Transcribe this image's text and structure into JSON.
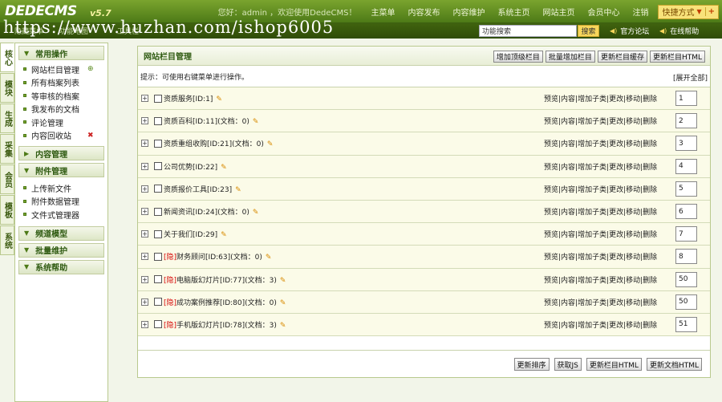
{
  "header": {
    "logo": "DEDECMS",
    "version": "v5.7",
    "welcome": "您好：admin ，欢迎使用DedeCMS！",
    "nav": [
      "主菜单",
      "内容发布",
      "内容维护",
      "系统主页",
      "网站主页",
      "会员中心",
      "注销"
    ],
    "quick_label": "快捷方式",
    "quick_plus": "+"
  },
  "subbar": {
    "items": [
      "隐藏菜单",
      "功能地图",
      "工具栏"
    ],
    "watermark": "https://www.huzhan.com/ishop6005",
    "search_value": "功能搜索",
    "search_button": "搜索",
    "links": [
      "官方论坛",
      "在线帮助"
    ]
  },
  "vtabs": [
    "核心",
    "模块",
    "生成",
    "采集",
    "会员",
    "模板",
    "系统"
  ],
  "menu": {
    "groups": [
      {
        "title": "常用操作",
        "items": [
          "网站栏目管理",
          "所有档案列表",
          "等审核的档案",
          "我发布的文档",
          "评论管理",
          "内容回收站"
        ]
      },
      {
        "title": "内容管理",
        "items": []
      },
      {
        "title": "附件管理",
        "items": [
          "上传新文件",
          "附件数据管理",
          "文件式管理器"
        ]
      },
      {
        "title": "频道模型",
        "items": []
      },
      {
        "title": "批量维护",
        "items": []
      },
      {
        "title": "系统帮助",
        "items": []
      }
    ]
  },
  "main": {
    "title": "网站栏目管理",
    "head_buttons": [
      "增加顶级栏目",
      "批量增加栏目",
      "更新栏目缓存",
      "更新栏目HTML"
    ],
    "tip": "提示：可使用右键菜单进行操作。",
    "expand_all": "[展开全部]",
    "ops": "预览|内容|增加子类|更改|移动|删除",
    "rows": [
      {
        "tag": "",
        "name": "资质服务[ID:1]",
        "order": "1"
      },
      {
        "tag": "",
        "name": "资质百科[ID:11](文档：0)",
        "order": "2"
      },
      {
        "tag": "",
        "name": "资质重组收购[ID:21](文档：0)",
        "order": "3"
      },
      {
        "tag": "",
        "name": "公司优势[ID:22]",
        "order": "4"
      },
      {
        "tag": "",
        "name": "资质报价工具[ID:23]",
        "order": "5"
      },
      {
        "tag": "",
        "name": "新闻资讯[ID:24](文档：0)",
        "order": "6"
      },
      {
        "tag": "",
        "name": "关于我们[ID:29]",
        "order": "7"
      },
      {
        "tag": "[隐]",
        "name": "财务顾问[ID:63](文档：0)",
        "order": "8"
      },
      {
        "tag": "[隐]",
        "name": "电脑版幻灯片[ID:77](文档：3)",
        "order": "50"
      },
      {
        "tag": "[隐]",
        "name": "成功案例推荐[ID:80](文档：0)",
        "order": "50"
      },
      {
        "tag": "[隐]",
        "name": "手机版幻灯片[ID:78](文档：3)",
        "order": "51"
      }
    ],
    "foot_buttons": [
      "更新排序",
      "获取JS",
      "更新栏目HTML",
      "更新文档HTML"
    ]
  }
}
